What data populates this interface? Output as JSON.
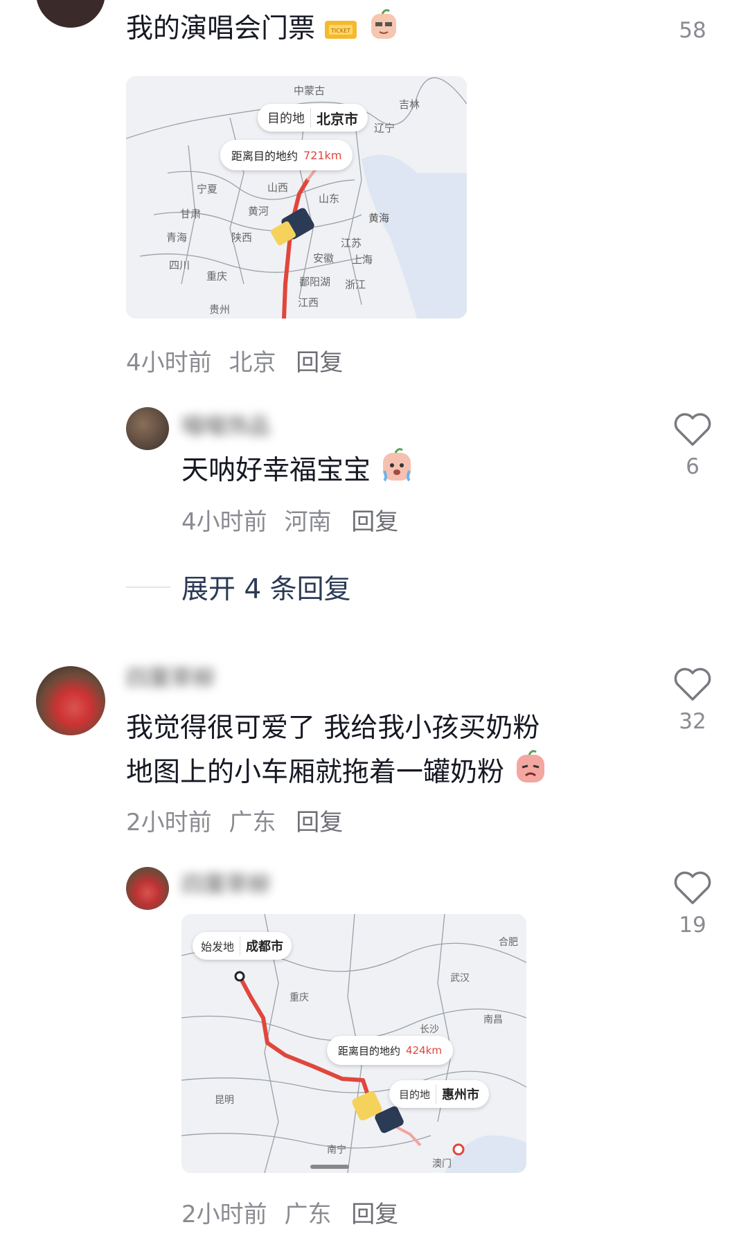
{
  "comments": [
    {
      "text": "我的演唱会门票",
      "likes": "58",
      "time": "4小时前",
      "location": "北京",
      "reply_label": "回复",
      "map": {
        "dest_tag": "目的地",
        "dest_city": "北京市",
        "distance_label": "距离目的地约",
        "distance_value": "721km",
        "places": [
          "中蒙古",
          "吉林",
          "辽宁",
          "宁夏",
          "甘肃",
          "山西",
          "山东",
          "黄河",
          "黄海",
          "陕西",
          "青海",
          "江苏",
          "安徽",
          "上海",
          "四川",
          "重庆",
          "鄱阳湖",
          "浙江",
          "江西",
          "贵州"
        ]
      }
    },
    {
      "name": "喵喵饰品",
      "text": "天呐好幸福宝宝",
      "likes": "6",
      "time": "4小时前",
      "location": "河南",
      "reply_label": "回复"
    },
    {
      "expand_label": "展开 4 条回复"
    },
    {
      "name": "四葉草柳",
      "text_line1": "我觉得很可爱了  我给我小孩买奶粉",
      "text_line2": "地图上的小车厢就拖着一罐奶粉",
      "likes": "32",
      "time": "2小时前",
      "location": "广东",
      "reply_label": "回复"
    },
    {
      "name": "四葉草柳",
      "likes": "19",
      "time": "2小时前",
      "location": "广东",
      "reply_label": "回复",
      "map": {
        "origin_tag": "始发地",
        "origin_city": "成都市",
        "dest_tag": "目的地",
        "dest_city": "惠州市",
        "distance_label": "距离目的地约",
        "distance_value": "424km",
        "places": [
          "合肥",
          "武汉",
          "重庆",
          "南昌",
          "长沙",
          "昆明",
          "南宁",
          "澳门"
        ]
      }
    }
  ],
  "colors": {
    "route": "#e0463c",
    "text": "#161823",
    "meta": "#8a8b91"
  },
  "icons": [
    "heart-outline-icon",
    "ticket-icon",
    "emoji-face-icon",
    "car-icon"
  ]
}
